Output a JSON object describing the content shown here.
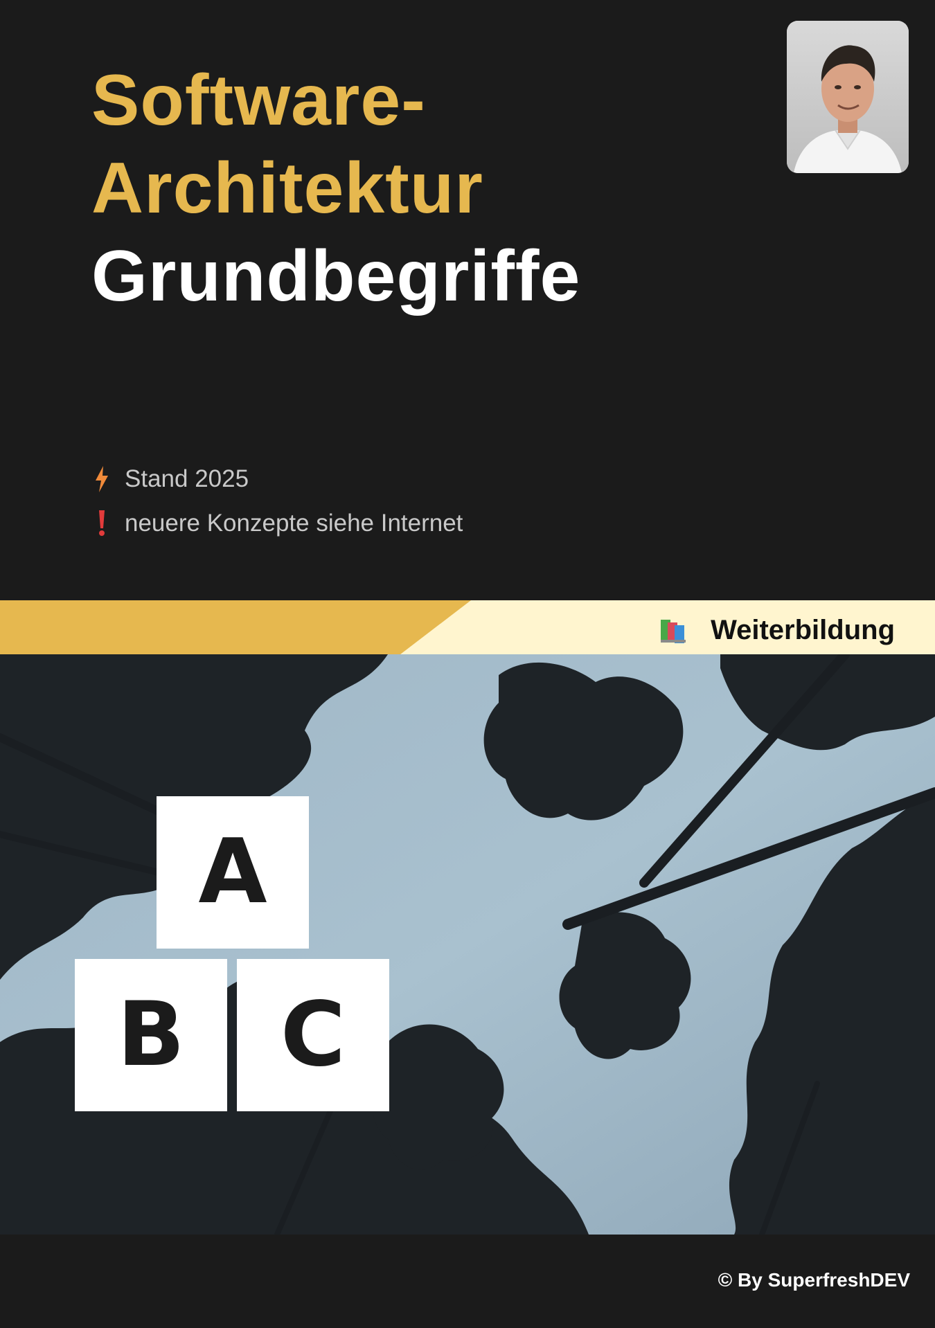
{
  "title": {
    "line1": "Software-",
    "line2": "Architektur",
    "line3": "Grundbegriffe"
  },
  "notes": [
    {
      "icon": "lightning-icon",
      "text": "Stand 2025",
      "color": "#f08a3a"
    },
    {
      "icon": "exclamation-icon",
      "text": "neuere Konzepte siehe Internet",
      "color": "#e23b3b"
    }
  ],
  "banner": {
    "label": "Weiterbildung",
    "icon": "books-icon"
  },
  "blocks": [
    "A",
    "B",
    "C"
  ],
  "footer": "© By SuperfreshDEV",
  "colors": {
    "background": "#1b1b1b",
    "accent": "#e6b84f",
    "banner_cream": "#fff5cf",
    "text_muted": "#c9c9c9"
  }
}
